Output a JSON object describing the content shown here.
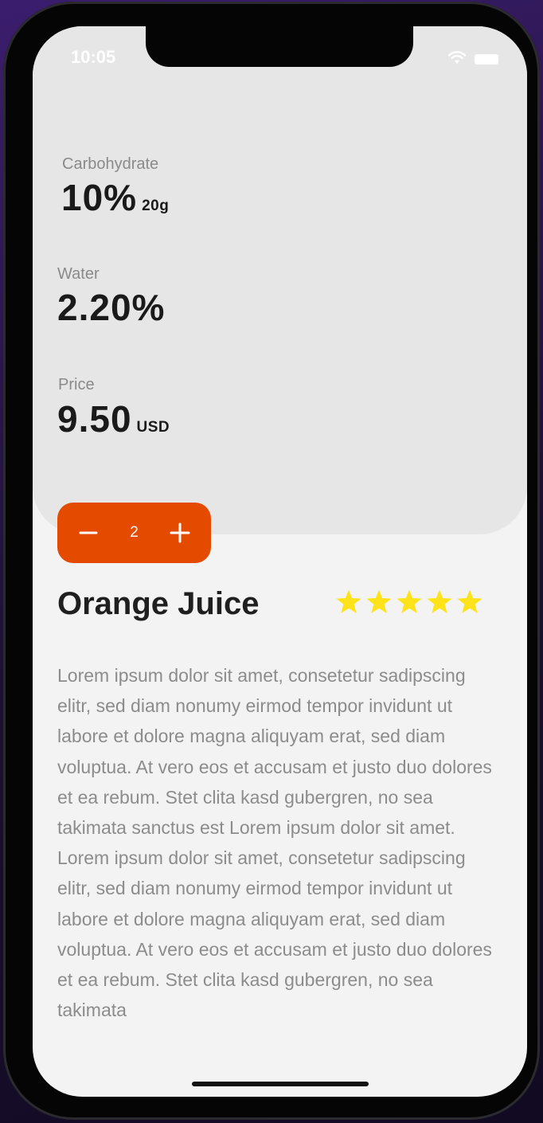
{
  "status_bar": {
    "time": "10:05",
    "icons": [
      "wifi-icon",
      "battery-icon"
    ]
  },
  "nutrition": [
    {
      "label": "Carbohydrate",
      "value": "10%",
      "unit": "20g"
    },
    {
      "label": "Water",
      "value": "2.20%",
      "unit": ""
    },
    {
      "label": "Price",
      "value": "9.50",
      "unit": "USD"
    }
  ],
  "stepper": {
    "quantity": "2",
    "decrement_icon": "minus-icon",
    "increment_icon": "plus-icon"
  },
  "product": {
    "title": "Orange Juice",
    "rating": 5,
    "rating_max": 5,
    "description": "Lorem ipsum dolor sit amet, consetetur sadipscing elitr, sed diam nonumy eirmod tempor invidunt ut labore et dolore magna aliquyam erat, sed diam voluptua. At vero eos et accusam et justo duo dolores et ea rebum. Stet clita kasd gubergren, no sea takimata sanctus est Lorem ipsum dolor sit amet. Lorem ipsum dolor sit amet, consetetur sadipscing elitr, sed diam nonumy eirmod tempor invidunt ut labore et dolore magna aliquyam erat, sed diam voluptua. At vero eos et accusam et justo duo dolores et ea rebum. Stet clita kasd gubergren, no sea takimata"
  },
  "colors": {
    "accent": "#e44a00",
    "star": "#ffe31a",
    "card": "#e6e6e6",
    "background": "#f3f3f3",
    "text_dark": "#1a1a1a",
    "text_muted": "#8c8c8c"
  }
}
